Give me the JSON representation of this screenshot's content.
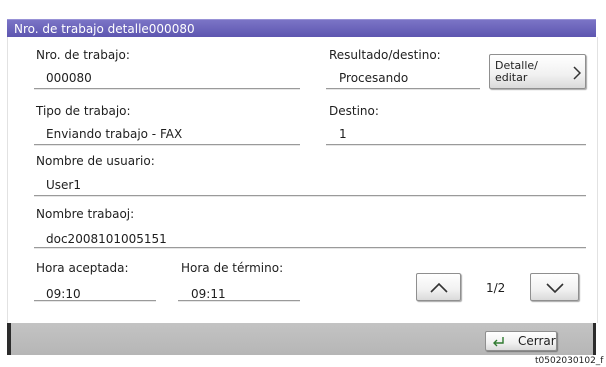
{
  "window": {
    "title": "Nro. de trabajo detalle000080"
  },
  "fields": {
    "job_number": {
      "label": "Nro. de trabajo:",
      "value": "000080"
    },
    "result": {
      "label": "Resultado/destino:",
      "value": "Procesando"
    },
    "job_type": {
      "label": "Tipo de trabajo:",
      "value": "Enviando trabajo - FAX"
    },
    "destination": {
      "label": "Destino:",
      "value": "1"
    },
    "user_name": {
      "label": "Nombre de usuario:",
      "value": "User1"
    },
    "job_name": {
      "label": "Nombre trabaoj:",
      "value": "doc2008101005151"
    },
    "accepted_time": {
      "label": "Hora aceptada:",
      "value": "09:10"
    },
    "end_time": {
      "label": "Hora de término:",
      "value": "09:11"
    }
  },
  "buttons": {
    "detail_edit": {
      "label": "Detalle/\neditar",
      "icon": "chevron-right-icon"
    },
    "page_up": {
      "icon": "chevron-up-icon"
    },
    "page_down": {
      "icon": "chevron-down-icon"
    },
    "close": {
      "label": "Cerrar",
      "icon": "return-arrow-icon"
    }
  },
  "pagination": {
    "current": 1,
    "total": 2,
    "text": "1/2"
  },
  "document_code": "t0502030102_f",
  "colors": {
    "title_bar": "#5d56b0",
    "footer_bar": "#bdbdbd",
    "field_rule": "#9a9a9a"
  }
}
